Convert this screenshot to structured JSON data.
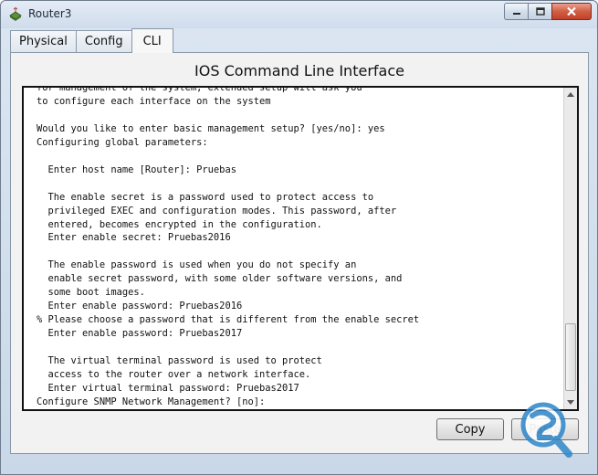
{
  "window": {
    "title": "Router3",
    "icon": "router-app-icon",
    "controls": [
      "minimize-icon",
      "maximize-icon",
      "close-icon"
    ]
  },
  "tabs": [
    {
      "label": "Physical",
      "active": false
    },
    {
      "label": "Config",
      "active": false
    },
    {
      "label": "CLI",
      "active": true
    }
  ],
  "panel": {
    "title": "IOS Command Line Interface"
  },
  "console": {
    "lines": [
      "for management of the system, extended setup will ask you",
      "to configure each interface on the system",
      "",
      "Would you like to enter basic management setup? [yes/no]: yes",
      "Configuring global parameters:",
      "",
      "  Enter host name [Router]: Pruebas",
      "",
      "  The enable secret is a password used to protect access to",
      "  privileged EXEC and configuration modes. This password, after",
      "  entered, becomes encrypted in the configuration.",
      "  Enter enable secret: Pruebas2016",
      "",
      "  The enable password is used when you do not specify an",
      "  enable secret password, with some older software versions, and",
      "  some boot images.",
      "  Enter enable password: Pruebas2016",
      "% Please choose a password that is different from the enable secret",
      "  Enter enable password: Pruebas2017",
      "",
      "  The virtual terminal password is used to protect",
      "  access to the router over a network interface.",
      "  Enter virtual terminal password: Pruebas2017",
      "Configure SNMP Network Management? [no]:"
    ]
  },
  "buttons": {
    "copy": "Copy",
    "paste": "Paste"
  },
  "colors": {
    "close_button": "#c2412a",
    "panel_background": "#f2f2f2",
    "console_border": "#111111",
    "watermark": "#2e86c8"
  },
  "watermark": {
    "icon": "magnifier-logo-icon"
  }
}
